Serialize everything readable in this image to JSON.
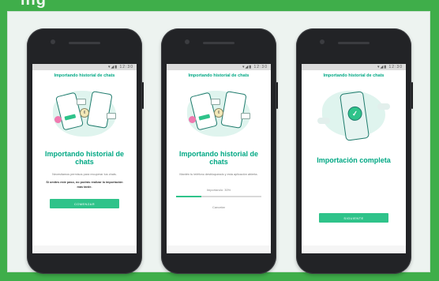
{
  "page_heading_fragment": "ing",
  "colors": {
    "brand": "#00a884",
    "button": "#2fc38a",
    "frame": "#3fae4a",
    "panel": "#edf3f0"
  },
  "phones": [
    {
      "status_icons": "▾◢▮ 12:30",
      "app_title": "Importando historial de chats",
      "illustration": "two-phones-transfer",
      "title": "Importando historial de chats",
      "text": "Necesitamos permisos para recuperar tus chats.",
      "bold_text": "Si omites este paso, no podrás realizar la importación más tarde.",
      "button_label": "COMENZAR"
    },
    {
      "status_icons": "▾◢▮ 12:30",
      "app_title": "Importando historial de chats",
      "illustration": "two-phones-transfer",
      "title": "Importando historial de chats",
      "text": "Mantén tu teléfono desbloqueado y esta aplicación abierta.",
      "progress_label": "Importando: 30%",
      "progress_fraction": 0.3,
      "cancel_label": "Cancelar"
    },
    {
      "status_icons": "▾◢▮ 12:30",
      "app_title": "Importando historial de chats",
      "illustration": "phone-check",
      "title": "Importación completa",
      "button_label": "SIGUIENTE"
    }
  ]
}
